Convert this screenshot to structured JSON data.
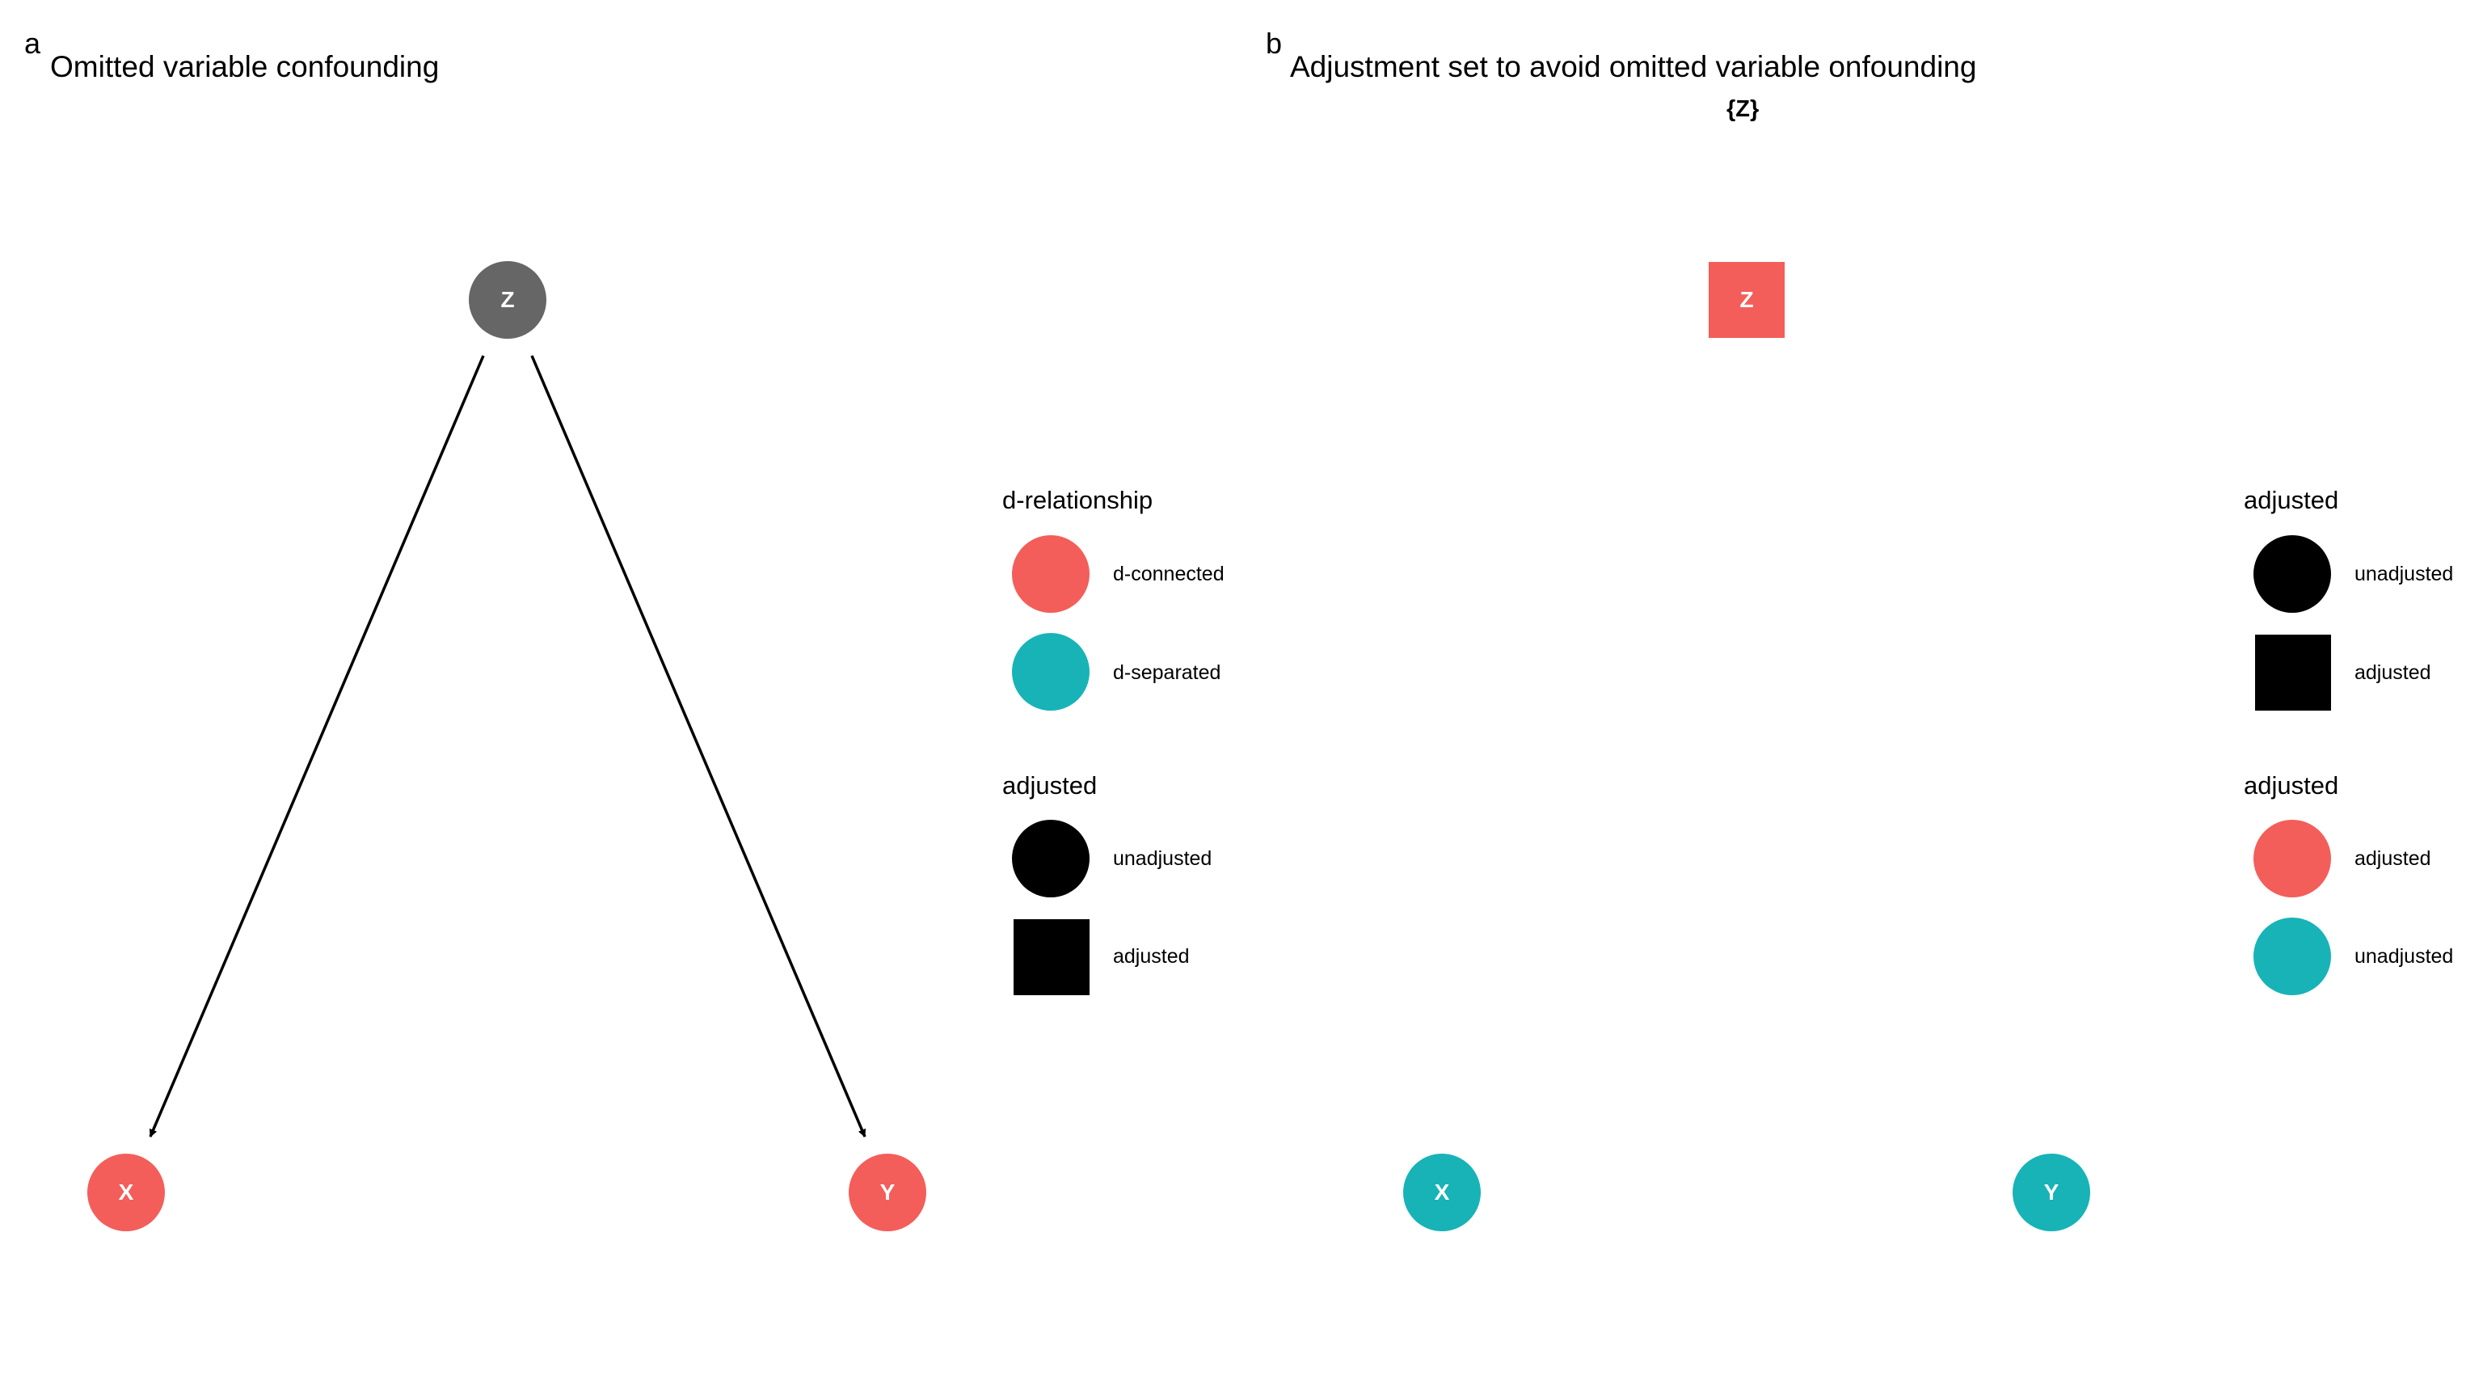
{
  "colors": {
    "d_connected": "#F35E5A",
    "d_separated": "#17B3B7",
    "exposure": "#666666",
    "black": "#000000",
    "edge": "#000000"
  },
  "panel_a": {
    "letter": "a",
    "title": "Omitted variable confounding",
    "nodes": {
      "z": {
        "label": "Z",
        "shape": "circle",
        "status": "exposure"
      },
      "x": {
        "label": "X",
        "shape": "circle",
        "status": "d-connected"
      },
      "y": {
        "label": "Y",
        "shape": "circle",
        "status": "d-connected"
      }
    },
    "edges": [
      {
        "from": "Z",
        "to": "X"
      },
      {
        "from": "Z",
        "to": "Y"
      }
    ],
    "legend": {
      "d_relationship": {
        "title": "d-relationship",
        "items": [
          {
            "label": "d-connected",
            "shape": "circle",
            "color": "#F35E5A"
          },
          {
            "label": "d-separated",
            "shape": "circle",
            "color": "#17B3B7"
          }
        ]
      },
      "adjusted": {
        "title": "adjusted",
        "items": [
          {
            "label": "unadjusted",
            "shape": "circle",
            "color": "#000000"
          },
          {
            "label": "adjusted",
            "shape": "square",
            "color": "#000000"
          }
        ]
      }
    }
  },
  "panel_b": {
    "letter": "b",
    "title": "Adjustment set to avoid omitted variable onfounding",
    "subtitle": "{Z}",
    "nodes": {
      "z": {
        "label": "Z",
        "shape": "square",
        "status": "adjusted"
      },
      "x": {
        "label": "X",
        "shape": "circle",
        "status": "unadjusted"
      },
      "y": {
        "label": "Y",
        "shape": "circle",
        "status": "unadjusted"
      }
    },
    "legend": {
      "shape": {
        "title": "adjusted",
        "items": [
          {
            "label": "unadjusted",
            "shape": "circle",
            "color": "#000000"
          },
          {
            "label": "adjusted",
            "shape": "square",
            "color": "#000000"
          }
        ]
      },
      "color": {
        "title": "adjusted",
        "items": [
          {
            "label": "adjusted",
            "shape": "circle",
            "color": "#F35E5A"
          },
          {
            "label": "unadjusted",
            "shape": "circle",
            "color": "#17B3B7"
          }
        ]
      }
    }
  }
}
